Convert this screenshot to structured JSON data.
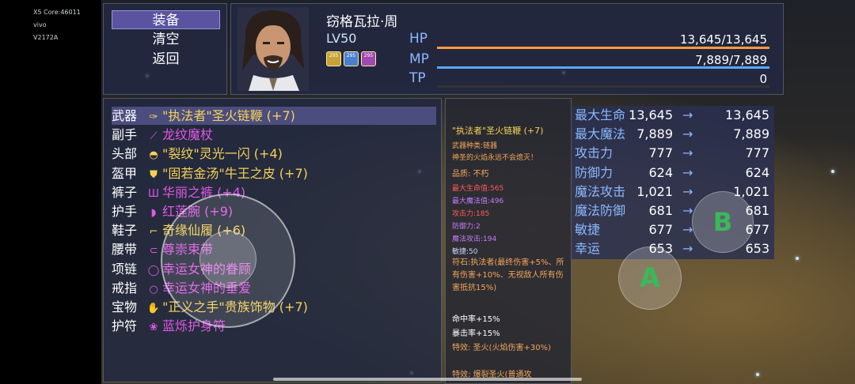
{
  "device": {
    "line1": "X5  Core:46011",
    "line2": "vivo",
    "line3": "V2172A"
  },
  "menu": {
    "items": [
      "装备",
      "清空",
      "返回"
    ]
  },
  "character": {
    "name": "窃格瓦拉·周",
    "level": "LV50",
    "badges": [
      {
        "text": "295"
      },
      {
        "text": "295"
      },
      {
        "text": "295"
      }
    ],
    "hp": {
      "label": "HP",
      "value": "13,645/13,645",
      "fill": 1.0
    },
    "mp": {
      "label": "MP",
      "value": "7,889/7,889",
      "fill": 1.0
    },
    "tp": {
      "label": "TP",
      "value": "0",
      "fill": 0
    }
  },
  "equipment": [
    {
      "slot": "武器",
      "name": "\"执法者\"圣火链鞭 (+7)",
      "color": "#f5d255",
      "icon": "whip-icon",
      "glyph": "✑"
    },
    {
      "slot": "副手",
      "name": "龙纹魔杖",
      "color": "#e257e8",
      "icon": "wand-icon",
      "glyph": "⟋"
    },
    {
      "slot": "头部",
      "name": "\"裂纹\"灵光一闪 (+4)",
      "color": "#f5d255",
      "icon": "helmet-icon",
      "glyph": "◓"
    },
    {
      "slot": "盔甲",
      "name": "\"固若金汤\"牛王之皮 (+7)",
      "color": "#f5d255",
      "icon": "armor-icon",
      "glyph": "⛊"
    },
    {
      "slot": "裤子",
      "name": "华丽之裤 (+4)",
      "color": "#e257e8",
      "icon": "pants-icon",
      "glyph": "Ш"
    },
    {
      "slot": "护手",
      "name": "红莲腕 (+9)",
      "color": "#e257e8",
      "icon": "gauntlet-icon",
      "glyph": "◗"
    },
    {
      "slot": "鞋子",
      "name": "奇缘仙履 (+6)",
      "color": "#f5d255",
      "icon": "boots-icon",
      "glyph": "⌐"
    },
    {
      "slot": "腰带",
      "name": "尊崇束带",
      "color": "#e257e8",
      "icon": "belt-icon",
      "glyph": "⊂"
    },
    {
      "slot": "项链",
      "name": "幸运女神的眷顾",
      "color": "#e257e8",
      "icon": "necklace-icon",
      "glyph": "◯"
    },
    {
      "slot": "戒指",
      "name": "幸运女神的垂爱",
      "color": "#e257e8",
      "icon": "ring-icon",
      "glyph": "○"
    },
    {
      "slot": "宝物",
      "name": "\"正义之手\"贵族饰物 (+7)",
      "color": "#f5d255",
      "icon": "treasure-icon",
      "glyph": "✋"
    },
    {
      "slot": "护符",
      "name": "蓝烁护身符",
      "color": "#e257e8",
      "icon": "amulet-icon",
      "glyph": "❀"
    }
  ],
  "detail": {
    "title": "\"执法者\"圣火链鞭 (+7)",
    "type": "武器种类:链器",
    "desc": "神圣的火焰永远不会熄灭！",
    "quality": "品质: 不朽",
    "lines": [
      {
        "text": "最大生命值:565",
        "color": "#ff5a5a"
      },
      {
        "text": "最大魔法值:496",
        "color": "#c07cff"
      },
      {
        "text": "攻击力:185",
        "color": "#ff5a5a"
      },
      {
        "text": "防御力:2",
        "color": "#c07cff"
      },
      {
        "text": "魔法攻击:194",
        "color": "#c07cff"
      },
      {
        "text": "敏捷:50",
        "color": "#cfd0ff"
      }
    ],
    "rune": "符石:执法者(最终伤害+5%、所有伤害+10%、无视敌人所有伤害抵抗15%)",
    "hit": "命中率+15%",
    "crit": "暴击率+15%",
    "special1": "特效: 圣火(火焰伤害+30%)",
    "special2": "特效: 爆裂圣火(普通攻"
  },
  "stats": [
    {
      "label": "最大生命",
      "from": "13,645",
      "to": "13,645"
    },
    {
      "label": "最大魔法",
      "from": "7,889",
      "to": "7,889"
    },
    {
      "label": "攻击力",
      "from": "777",
      "to": "777"
    },
    {
      "label": "防御力",
      "from": "624",
      "to": "624"
    },
    {
      "label": "魔法攻击",
      "from": "1,021",
      "to": "1,021"
    },
    {
      "label": "魔法防御",
      "from": "681",
      "to": "681"
    },
    {
      "label": "敏捷",
      "from": "677",
      "to": "677"
    },
    {
      "label": "幸运",
      "from": "653",
      "to": "653"
    }
  ],
  "arrow": "→",
  "buttons": {
    "a": "A",
    "b": "B"
  },
  "colors": {
    "hp": "#ff9a3c",
    "mp": "#5aa7ff",
    "accent": "#5a53a0"
  }
}
